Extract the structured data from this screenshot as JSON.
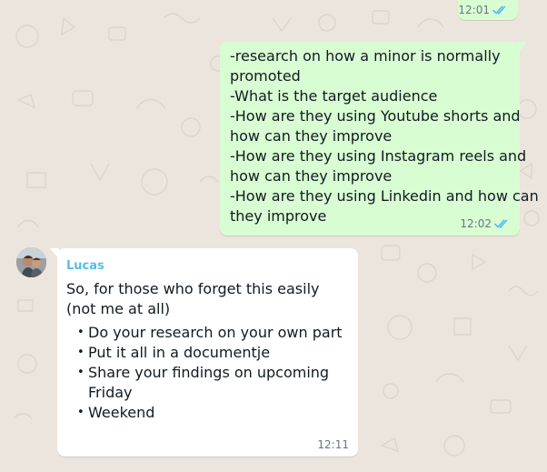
{
  "chat": {
    "messages": [
      {
        "direction": "outgoing",
        "time": "12:01",
        "status": "read"
      },
      {
        "direction": "outgoing",
        "lines": [
          "-research on how a minor is normally",
          "promoted",
          "-What is the target audience",
          "-How are they using Youtube shorts and",
          "how can they improve",
          "-How are they using Instagram reels and",
          "how can they improve",
          "-How are they using Linkedin and how can",
          "they improve"
        ],
        "time": "12:02",
        "status": "read"
      },
      {
        "direction": "incoming",
        "sender": "Lucas",
        "intro": "So, for those who forget this easily (not me at all)",
        "bullets": [
          "Do your research on your own part",
          "Put it all in a documentje",
          "Share your findings on upcoming Friday",
          "Weekend"
        ],
        "time": "12:11"
      }
    ]
  },
  "colors": {
    "background": "#ece5dd",
    "outgoing_bubble": "#d9fdd3",
    "incoming_bubble": "#ffffff",
    "sender_name": "#53bdeb",
    "read_ticks": "#53bdeb",
    "meta_text": "#667781"
  },
  "icons": {
    "read_status": "double-check-icon"
  }
}
